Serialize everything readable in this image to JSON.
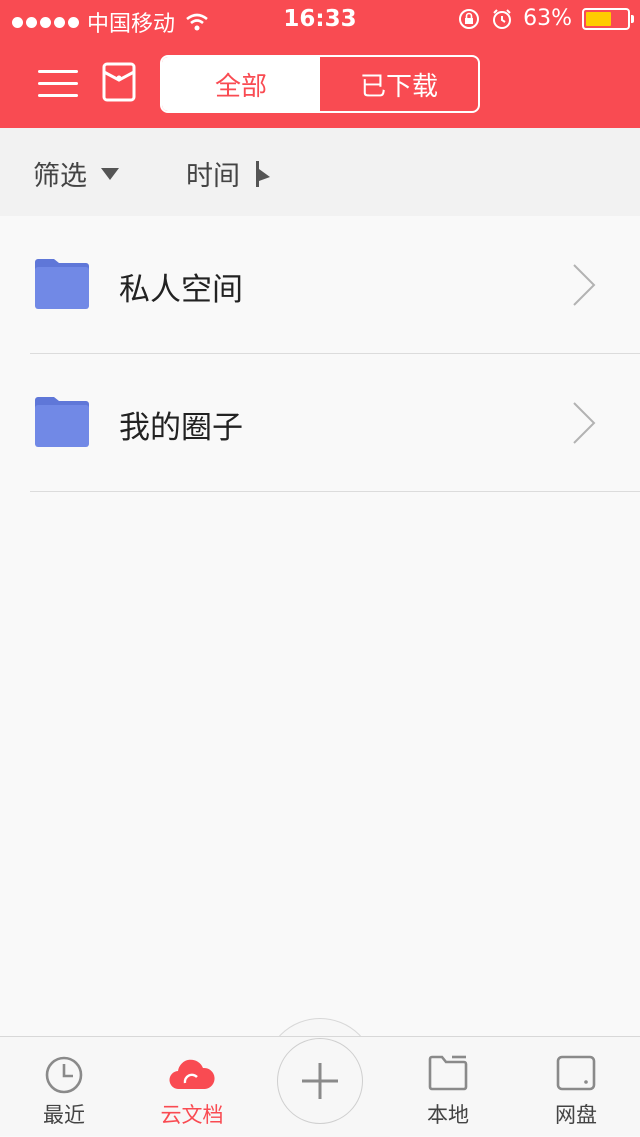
{
  "status_bar": {
    "carrier": "中国移动",
    "time": "16:33",
    "battery_text": "63%",
    "battery_level": 0.63,
    "battery_color": "#ffcc00"
  },
  "header": {
    "menu_icon": "hamburger-menu-icon",
    "envelope_icon": "envelope-icon",
    "tabs": [
      {
        "label": "全部",
        "active": true
      },
      {
        "label": "已下载",
        "active": false
      }
    ],
    "accent_color": "#f94b52"
  },
  "filter_bar": {
    "filter_label": "筛选",
    "sort_label": "时间"
  },
  "folders": [
    {
      "name": "私人空间",
      "icon": "folder-icon"
    },
    {
      "name": "我的圈子",
      "icon": "folder-icon"
    }
  ],
  "tab_bar": {
    "items": [
      {
        "label": "最近",
        "icon": "clock-icon",
        "active": false
      },
      {
        "label": "云文档",
        "icon": "cloud-icon",
        "active": true
      },
      {
        "label": "",
        "icon": "plus-icon",
        "active": false
      },
      {
        "label": "本地",
        "icon": "folder-outline-icon",
        "active": false
      },
      {
        "label": "网盘",
        "icon": "drive-icon",
        "active": false
      }
    ]
  }
}
